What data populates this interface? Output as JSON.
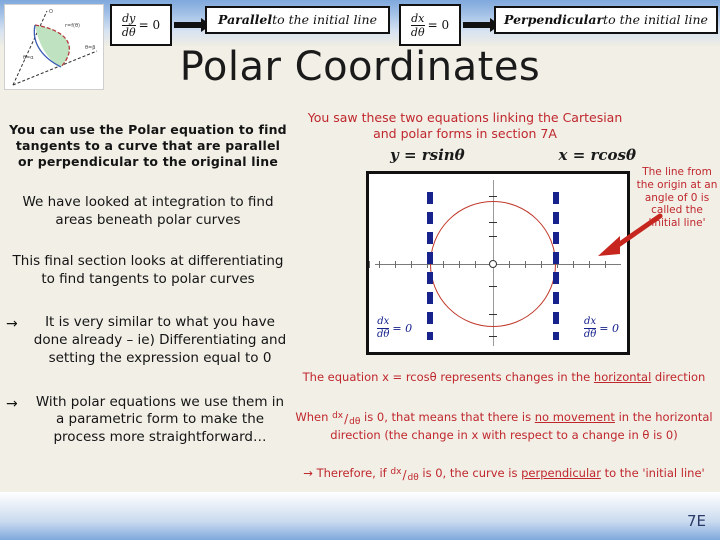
{
  "slide": {
    "title": "Polar Coordinates",
    "page_number": "7E",
    "background_color": "#F1EFE6",
    "accent_red": "#C0272D",
    "accent_blue": "#17228C",
    "curve_red": "#C0392B"
  },
  "flow": {
    "box1": {
      "numerator": "dy",
      "denominator": "dθ",
      "equals": "= 0"
    },
    "box2_bold": "Parallel",
    "box2_rest": " to the initial line",
    "box3": {
      "numerator": "dx",
      "denominator": "dθ",
      "equals": "= 0"
    },
    "box4_bold": "Perpendicular",
    "box4_rest": " to the initial line"
  },
  "left_column": {
    "intro_bold": "You can use the Polar equation to find tangents to a curve that are parallel or perpendicular to the original line",
    "para_1": "We have looked at integration to find areas beneath polar curves",
    "para_2": "This final section looks at differentiating to find tangents to polar curves",
    "bullet_marker": "→",
    "bullet_1": "It is very similar to what you have done already – ie) Differentiating and setting the expression equal to 0",
    "bullet_2": "With polar equations we use them in a parametric form to make the process more straightforward…"
  },
  "right_column": {
    "heading": "You saw these two equations linking the Cartesian and polar forms in section 7A",
    "equation_y": "y = rsinθ",
    "equation_x": "x = rcosθ",
    "note_initial_line": "The line from the origin at an angle of 0 is called the 'initial line'",
    "line_1_a": "The equation x = rcosθ represents changes in the ",
    "line_1_underline": "horizontal",
    "line_1_b": " direction",
    "line_2_a": "When ",
    "line_2_frac_num": "dx",
    "line_2_frac_den": "dθ",
    "line_2_b": " is 0, that means that there is ",
    "line_2_underline": "no movement",
    "line_2_c": " in the horizontal direction (the change in x with respect to a change in θ is 0)",
    "line_3_marker": "→",
    "line_3_a": " Therefore, if ",
    "line_3_frac_num": "dx",
    "line_3_frac_den": "dθ",
    "line_3_b": " is 0, the curve is ",
    "line_3_underline": "perpendicular",
    "line_3_c": " to the 'initial line'"
  },
  "graph": {
    "dash_label_left_num": "dx",
    "dash_label_left_den": "dθ",
    "dash_label_left_eq": "= 0",
    "dash_label_right_num": "dx",
    "dash_label_right_den": "dθ",
    "dash_label_right_eq": "= 0"
  },
  "thumbnail": {
    "alt": "polar-area-sketch"
  }
}
